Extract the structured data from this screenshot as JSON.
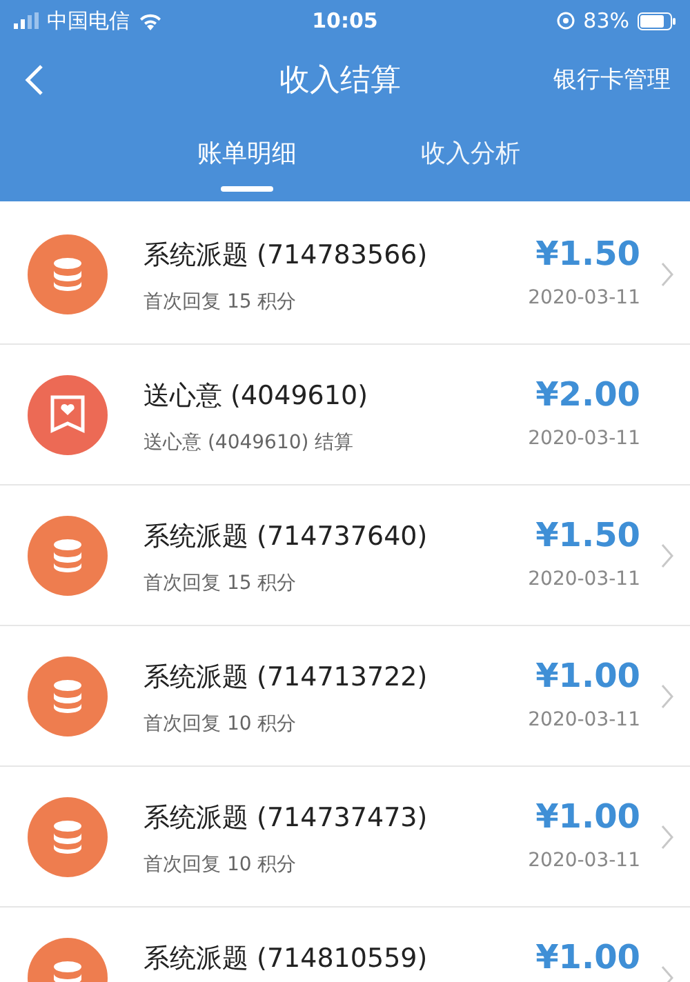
{
  "status_bar": {
    "carrier": "中国电信",
    "time": "10:05",
    "battery": "83%"
  },
  "nav": {
    "title": "收入结算",
    "action": "银行卡管理"
  },
  "tabs": [
    {
      "label": "账单明细",
      "selected": true
    },
    {
      "label": "收入分析",
      "selected": false
    }
  ],
  "records": [
    {
      "kind": "coins",
      "title": "系统派题 (714783566)",
      "subtitle": "首次回复 15 积分",
      "amount": "¥1.50",
      "date": "2020-03-11",
      "chevron": true
    },
    {
      "kind": "gift",
      "title": "送心意 (4049610)",
      "subtitle": "送心意 (4049610) 结算",
      "amount": "¥2.00",
      "date": "2020-03-11",
      "chevron": false
    },
    {
      "kind": "coins",
      "title": "系统派题 (714737640)",
      "subtitle": "首次回复 15 积分",
      "amount": "¥1.50",
      "date": "2020-03-11",
      "chevron": true
    },
    {
      "kind": "coins",
      "title": "系统派题 (714713722)",
      "subtitle": "首次回复 10 积分",
      "amount": "¥1.00",
      "date": "2020-03-11",
      "chevron": true
    },
    {
      "kind": "coins",
      "title": "系统派题 (714737473)",
      "subtitle": "首次回复 10 积分",
      "amount": "¥1.00",
      "date": "2020-03-11",
      "chevron": true
    },
    {
      "kind": "coins",
      "title": "系统派题 (714810559)",
      "amount": "¥1.00",
      "chevron": true
    }
  ]
}
